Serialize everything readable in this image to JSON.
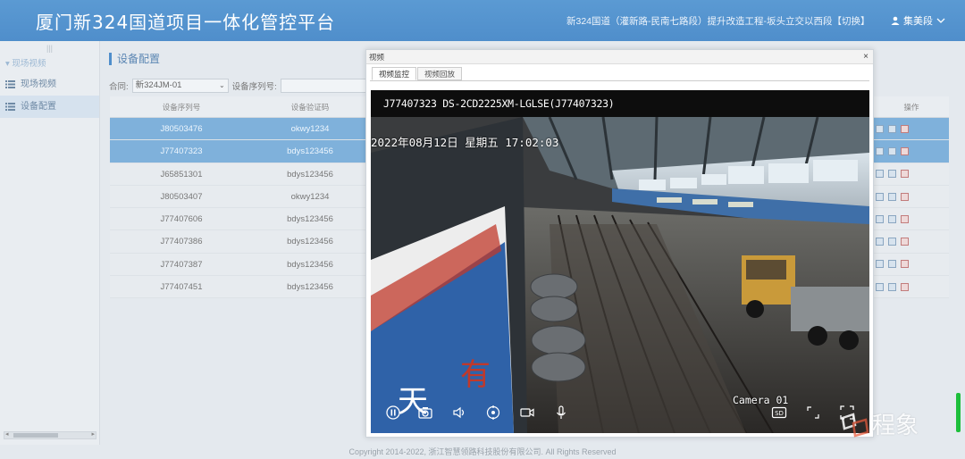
{
  "header": {
    "title": "厦门新324国道项目一体化管控平台",
    "project": "新324国道（灌新路-民南七路段）提升改造工程-坂头立交以西段【切换】",
    "user": "集美段"
  },
  "sidebar": {
    "group": "现场视频",
    "items": [
      {
        "label": "现场视频",
        "icon": "list-icon"
      },
      {
        "label": "设备配置",
        "icon": "list-icon"
      }
    ]
  },
  "main": {
    "page_title": "设备配置",
    "filter_contract_label": "合同:",
    "filter_contract_value": "新324JM-01",
    "filter_serial_label": "设备序列号:",
    "columns": [
      "设备序列号",
      "设备验证码"
    ],
    "options_header": "操作",
    "rows": [
      {
        "serial": "J80503476",
        "code": "okwy1234",
        "selected": true
      },
      {
        "serial": "J77407323",
        "code": "bdys123456",
        "selected": true
      },
      {
        "serial": "J65851301",
        "code": "bdys123456",
        "selected": false
      },
      {
        "serial": "J80503407",
        "code": "okwy1234",
        "selected": false
      },
      {
        "serial": "J77407606",
        "code": "bdys123456",
        "selected": false
      },
      {
        "serial": "J77407386",
        "code": "bdys123456",
        "selected": false
      },
      {
        "serial": "J77407387",
        "code": "bdys123456",
        "selected": false
      },
      {
        "serial": "J77407451",
        "code": "bdys123456",
        "selected": false
      }
    ]
  },
  "modal": {
    "title": "视频",
    "close": "×",
    "tabs": [
      "视频监控",
      "视频回放"
    ],
    "stream_title": "J77407323  DS-2CD2225XM-LGLSE(J77407323)",
    "osd_datetime": "2022年08月12日  星期五  17:02:03",
    "camera_label": "Camera 01"
  },
  "footer": "Copyright 2014-2022, 浙江智慧领路科技股份有限公司. All Rights Reserved",
  "watermark": "程象",
  "colors": {
    "header_blue": "#4f8ecb",
    "selected_row": "#7fb1db",
    "scroll_green": "#1dbf3b"
  }
}
